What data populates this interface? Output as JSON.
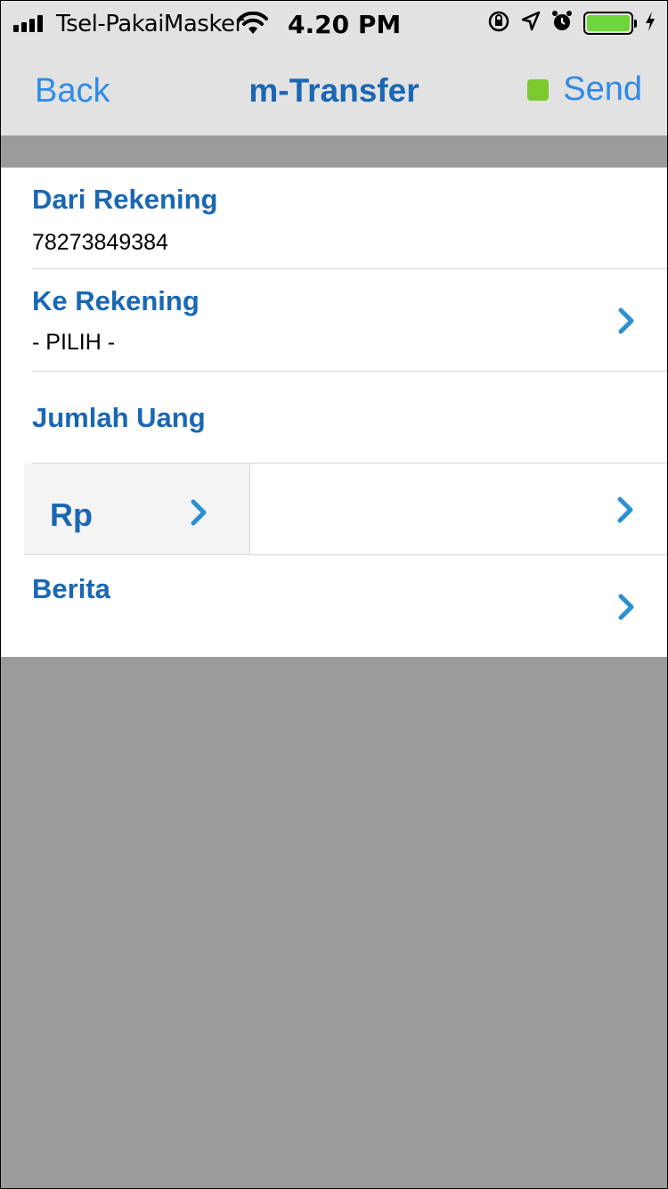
{
  "status_bar": {
    "carrier": "Tsel-PakaiMasker",
    "time": "4.20 PM",
    "icons": [
      "signal-icon",
      "wifi-icon",
      "orientation-lock-icon",
      "location-icon",
      "alarm-icon",
      "battery-icon",
      "charging-icon"
    ],
    "battery_level": 1.0,
    "battery_color": "#6ed53a"
  },
  "nav": {
    "back_label": "Back",
    "title": "m-Transfer",
    "send_label": "Send",
    "send_indicator_color": "#7cc92e"
  },
  "form": {
    "from_account": {
      "label": "Dari Rekening",
      "value": "78273849384"
    },
    "to_account": {
      "label": "Ke Rekening",
      "value": "- PILIH -"
    },
    "amount": {
      "label": "Jumlah Uang",
      "currency": "Rp",
      "value": ""
    },
    "message": {
      "label": "Berita"
    }
  },
  "colors": {
    "accent": "#1a67b3",
    "link": "#2f8ae6",
    "chevron": "#2a90d0",
    "background": "#9b9b9b"
  }
}
